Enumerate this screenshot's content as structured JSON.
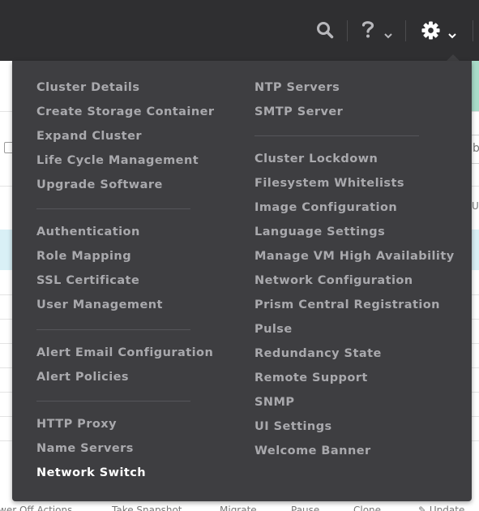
{
  "header": {
    "icons": [
      "search-icon",
      "help-icon",
      "gear-icon"
    ]
  },
  "background": {
    "partial_label_b": "b",
    "partial_label_u": "U",
    "bottom_actions": [
      "wer Off Actions",
      "Take Snapshot",
      "Migrate",
      "Pause",
      "Clone",
      "Update"
    ]
  },
  "menu": {
    "left_groups": [
      [
        "Cluster Details",
        "Create Storage Container",
        "Expand Cluster",
        "Life Cycle Management",
        "Upgrade Software"
      ],
      [
        "Authentication",
        "Role Mapping",
        "SSL Certificate",
        "User Management"
      ],
      [
        "Alert Email Configuration",
        "Alert Policies"
      ],
      [
        "HTTP Proxy",
        "Name Servers",
        "Network Switch"
      ]
    ],
    "right_groups": [
      [
        "NTP Servers",
        "SMTP Server"
      ],
      [
        "Cluster Lockdown",
        "Filesystem Whitelists",
        "Image Configuration",
        "Language Settings",
        "Manage VM High Availability",
        "Network Configuration",
        "Prism Central Registration",
        "Pulse",
        "Redundancy State",
        "Remote Support",
        "SNMP",
        "UI Settings",
        "Welcome Banner"
      ]
    ],
    "highlighted_item": "Network Switch"
  }
}
